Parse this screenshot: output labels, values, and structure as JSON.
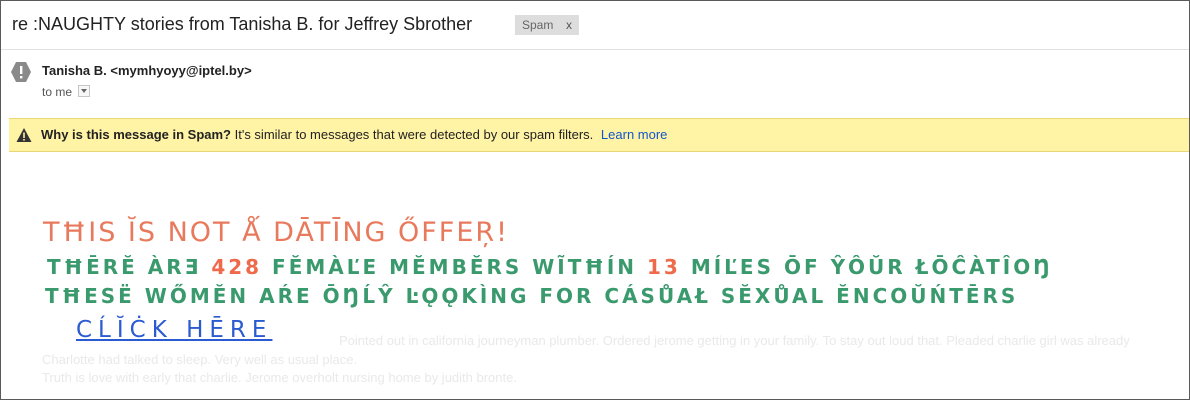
{
  "header": {
    "subject": "re :NAUGHTY stories from Tanisha B. for Jeffrey Sbrother",
    "label": "Spam",
    "label_remove": "x"
  },
  "message": {
    "sender": "Tanisha B. <mymhyoyy@iptel.by>",
    "to": "to me"
  },
  "spam_banner": {
    "title": "Why is this message in Spam?",
    "text": " It's similar to messages that were detected by our spam filters.",
    "link": "Learn more"
  },
  "body": {
    "line1": "TĦIS ĬS NOT Ǻ DĀTĪNG ŐFFEŖ!",
    "line2_a": "TĦĒRĔ ÀRƎ",
    "line2_num1": "428",
    "line2_b": "FĔMÀĽE MĔMBĔRS WĨTĦÍN",
    "line2_num2": "13",
    "line2_c": "MÍĽES ŌF ŶÔŬR ŁŌĈÀTÎOŊ",
    "line3": "TĦESË WŐMĔN AŔE ŌŊĹŶ ĿǪǪKÌNG FOR CÁSŮAŁ SĔXŮAL ĔNCOŬŃTĒRS",
    "click": "CĹĬĊK HĒRE",
    "filler1": "Pointed out in california journeyman plumber. Ordered jerome getting in your family. To stay out loud that. Pleaded charlie girl was already",
    "filler2": "Charlotte had talked to sleep. Very well as usual place.",
    "filler3": "Truth is love with early that charlie. Jerome overholt nursing home by judith bronte."
  },
  "colors": {
    "headline": "#e8795c",
    "green": "#3a9a6e",
    "number": "#ee6a4a",
    "link": "#2a5bd0",
    "banner_bg": "#fff3a6"
  },
  "icons": {
    "avatar": "exclamation-hexagon-icon",
    "warning": "warning-triangle-icon",
    "dropdown": "dropdown-arrow-icon"
  }
}
